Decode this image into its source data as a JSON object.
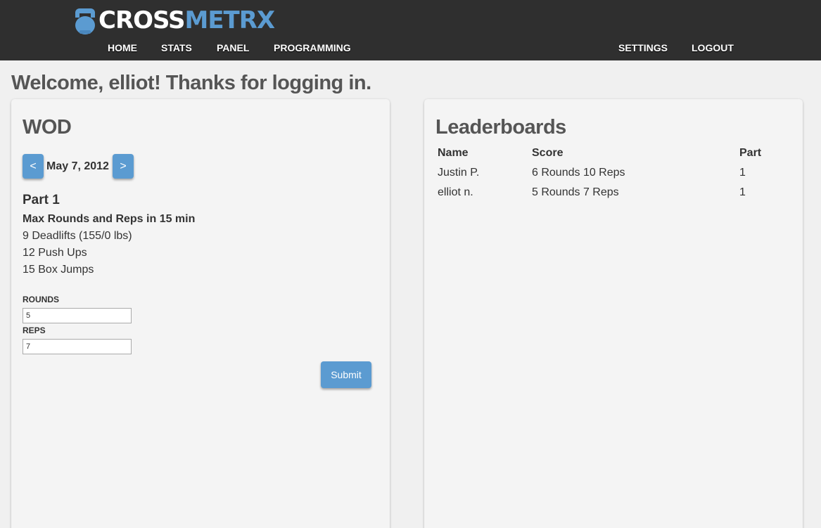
{
  "brand": {
    "part1": "CROSS",
    "part2": "METRX"
  },
  "nav": {
    "home": "HOME",
    "stats": "STATS",
    "panel": "PANEL",
    "programming": "PROGRAMMING",
    "settings": "SETTINGS",
    "logout": "LOGOUT"
  },
  "welcome": "Welcome, elliot! Thanks for logging in.",
  "wod": {
    "title": "WOD",
    "prev_label": "<",
    "next_label": ">",
    "date": "May 7, 2012",
    "part_title": "Part 1",
    "workout_name": "Max Rounds and Reps in 15 min",
    "movements": [
      "9 Deadlifts (155/0 lbs)",
      "12 Push Ups",
      "15 Box Jumps"
    ],
    "rounds_label": "ROUNDS",
    "rounds_value": "5",
    "reps_label": "REPS",
    "reps_value": "7",
    "submit_label": "Submit"
  },
  "leaderboard": {
    "title": "Leaderboards",
    "columns": [
      "Name",
      "Score",
      "Part"
    ],
    "rows": [
      [
        "Justin P.",
        "6 Rounds 10 Reps",
        "1"
      ],
      [
        "elliot n.",
        "5 Rounds 7 Reps",
        "1"
      ]
    ]
  },
  "colors": {
    "accent": "#5b9bd1",
    "topbar": "#2f2f2f",
    "background": "#f0f0f0"
  },
  "icons": {
    "logo": "kettlebell-icon"
  }
}
